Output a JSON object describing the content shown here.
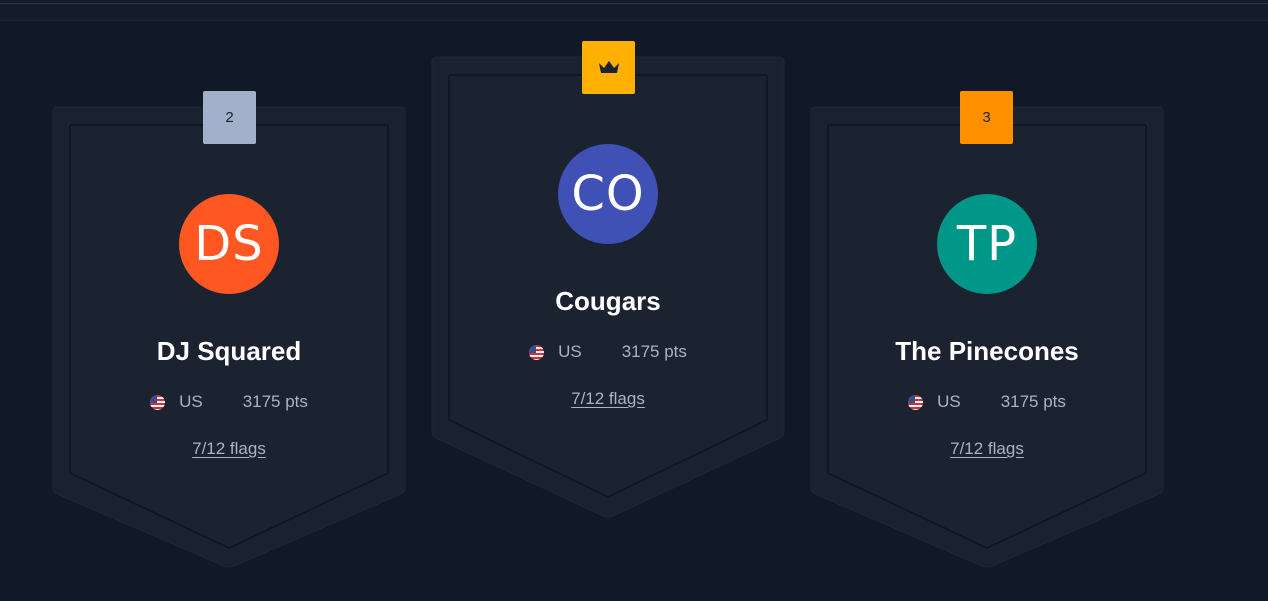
{
  "podium": [
    {
      "rank_label": "2",
      "initials": "DS",
      "avatar_color": "#ff5722",
      "badge_color": "#a3b0c9",
      "team_name": "DJ Squared",
      "country": "US",
      "points": "3175 pts",
      "flags": "7/12 flags"
    },
    {
      "rank_label": "",
      "rank_icon": "crown-icon",
      "initials": "CO",
      "avatar_color": "#3f51b5",
      "badge_color": "#ffb000",
      "team_name": "Cougars",
      "country": "US",
      "points": "3175 pts",
      "flags": "7/12 flags"
    },
    {
      "rank_label": "3",
      "initials": "TP",
      "avatar_color": "#009688",
      "badge_color": "#ff9100",
      "team_name": "The Pinecones",
      "country": "US",
      "points": "3175 pts",
      "flags": "7/12 flags"
    }
  ]
}
